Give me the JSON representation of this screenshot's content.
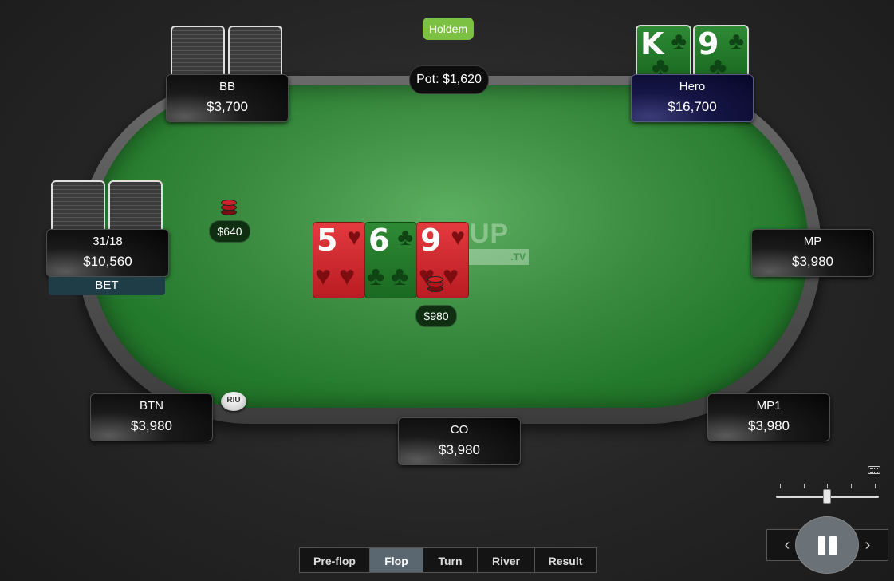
{
  "game_badge": "Holdem",
  "pot": {
    "label": "Pot: $1,620"
  },
  "watermark": {
    "main": "UP",
    "sub": ".TV"
  },
  "seats": [
    {
      "id": "bb",
      "name": "BB",
      "stack": "$3,700"
    },
    {
      "id": "hero",
      "name": "Hero",
      "stack": "$16,700"
    },
    {
      "id": "villain",
      "name": "31/18",
      "stack": "$10,560",
      "action": "BET"
    },
    {
      "id": "mp",
      "name": "MP",
      "stack": "$3,980"
    },
    {
      "id": "btn",
      "name": "BTN",
      "stack": "$3,980"
    },
    {
      "id": "co",
      "name": "CO",
      "stack": "$3,980"
    },
    {
      "id": "mp1",
      "name": "MP1",
      "stack": "$3,980"
    }
  ],
  "hero_cards": [
    {
      "rank": "K",
      "suit": "clubs",
      "suit_symbol": "♣"
    },
    {
      "rank": "9",
      "suit": "clubs",
      "suit_symbol": "♣"
    }
  ],
  "board": [
    {
      "rank": "5",
      "suit": "hearts",
      "suit_symbol": "♥"
    },
    {
      "rank": "6",
      "suit": "clubs",
      "suit_symbol": "♣"
    },
    {
      "rank": "9",
      "suit": "hearts",
      "suit_symbol": "♥"
    }
  ],
  "bets": [
    {
      "player": "31/18",
      "amount": "$640"
    },
    {
      "player": "Hero",
      "amount": "$980"
    }
  ],
  "dealer_button": {
    "label": "RIU"
  },
  "streets": {
    "tabs": [
      "Pre-flop",
      "Flop",
      "Turn",
      "River",
      "Result"
    ],
    "active": "Flop"
  },
  "controls": {
    "prev_symbol": "‹",
    "next_symbol": "›",
    "speed_level": 0.5
  },
  "colors": {
    "felt": "#3f8f44",
    "hearts_card": "#d12a30",
    "clubs_card": "#2a8a30",
    "badge": "#7dc142",
    "hero_seat": "#161646",
    "active_tab": "#5b6770"
  }
}
